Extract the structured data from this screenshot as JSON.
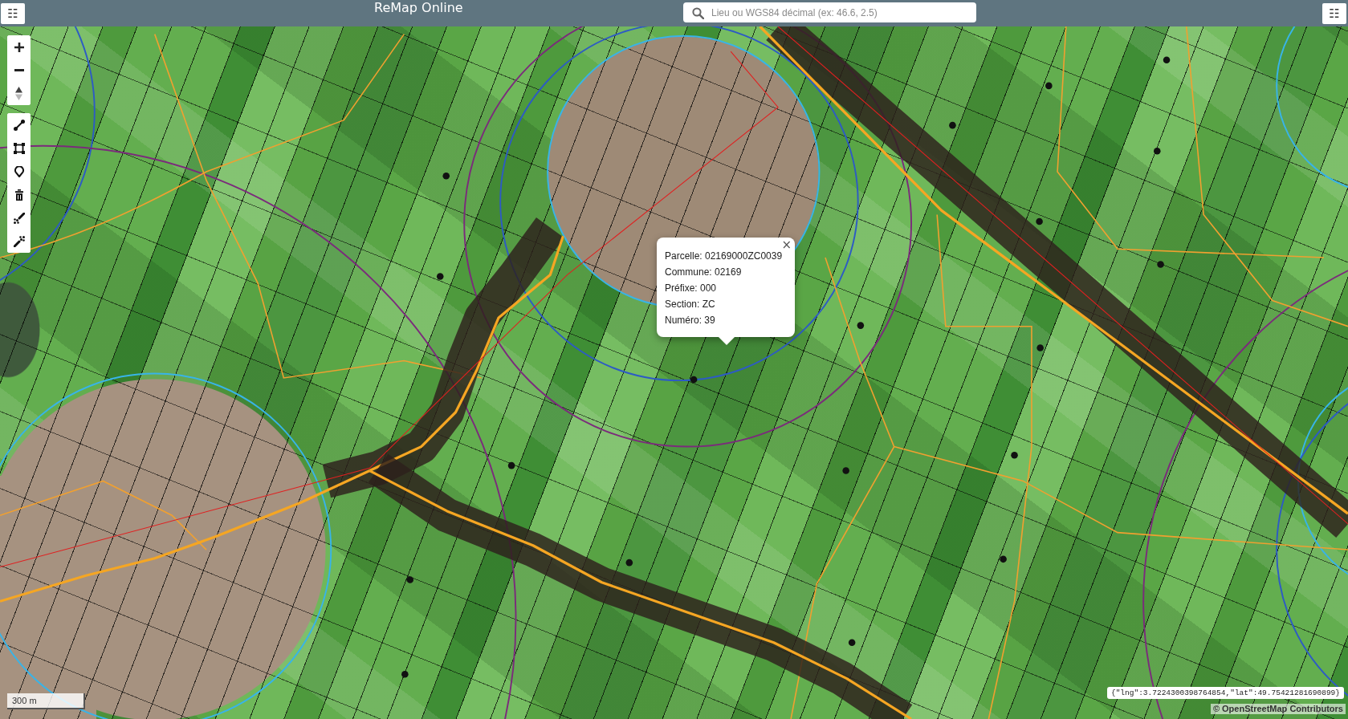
{
  "header": {
    "menu_left": "☷",
    "title": "ReMap Online",
    "search": {
      "placeholder": "Lieu ou WGS84 décimal (ex: 46.6, 2.5)"
    },
    "menu_right": "☷"
  },
  "popup": {
    "close": "×",
    "lines": [
      "Parcelle: 02169000ZC0039",
      "Commune: 02169",
      "Préfixe: 000",
      "Section: ZC",
      "Numéro: 39"
    ]
  },
  "scale_bar": "300 m",
  "cursor_coordinates": "{\"lng\":3.7224300398764854,\"lat\":49.75421281690899}",
  "attribution": "© OpenStreetMap Contributors"
}
